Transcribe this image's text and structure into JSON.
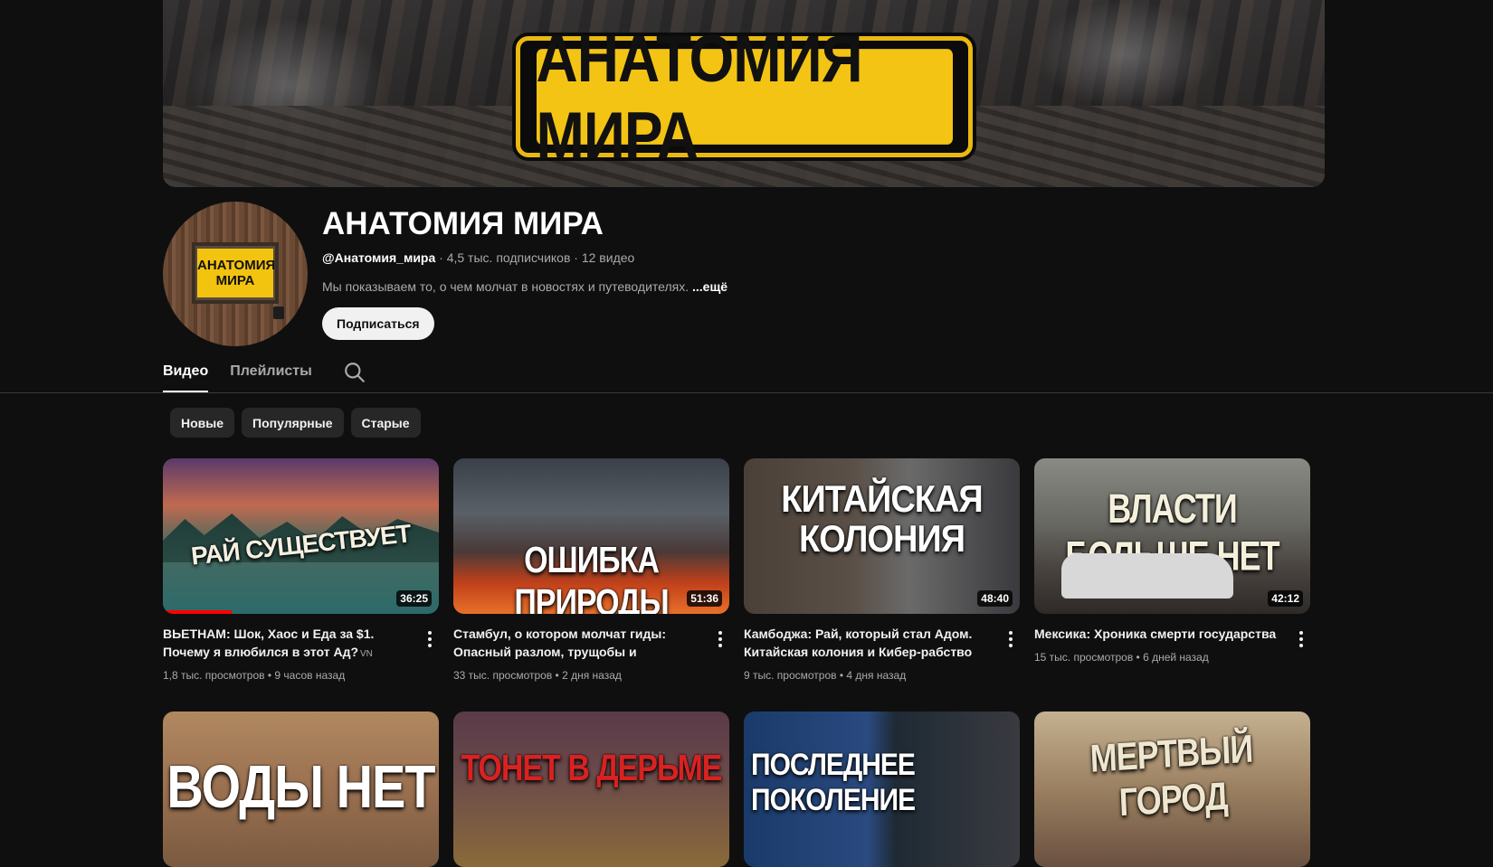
{
  "banner": {
    "logo_text": "АНАТОМИЯ МИРА"
  },
  "channel": {
    "avatar_text": "АНАТОМИЯ МИРА",
    "name": "АНАТОМИЯ МИРА",
    "handle": "@Анатомия_мира",
    "subscribers": " · 4,5 тыс. подписчиков",
    "video_count": " · 12 видео",
    "description": "Мы показываем то, о чем молчат в новостях и путеводителях. ",
    "more_label": "...ещё",
    "subscribe_label": "Подписаться"
  },
  "tabs": [
    {
      "label": "Видео",
      "active": true
    },
    {
      "label": "Плейлисты",
      "active": false
    }
  ],
  "tab_search_icon": "search-icon",
  "chips": [
    "Новые",
    "Популярные",
    "Старые"
  ],
  "videos": [
    {
      "thumb_text": "РАЙ СУЩЕСТВУЕТ",
      "duration": "36:25",
      "watched_fraction": 0.25,
      "title": "ВЬЕТНАМ: Шок, Хаос и Еда за $1. Почему я влюбился в этот Ад?",
      "lang_badge": "VN",
      "views": "1,8 тыс. просмотров",
      "age": "9 часов назад"
    },
    {
      "thumb_text": "ОШИБКА ПРИРОДЫ",
      "duration": "51:36",
      "title": "Стамбул, о котором молчат гиды: Опасный разлом, трущобы и реальная…",
      "views": "33 тыс. просмотров",
      "age": "2 дня назад"
    },
    {
      "thumb_text": "КИТАЙСКАЯ КОЛОНИЯ",
      "duration": "48:40",
      "title": "Камбоджа: Рай, который стал Адом. Китайская колония и Кибер-рабство",
      "views": "9 тыс. просмотров",
      "age": "4 дня назад"
    },
    {
      "thumb_text": "ВЛАСТИ БОЛЬШЕ НЕТ",
      "duration": "42:12",
      "title": "Мексика: Хроника смерти государства",
      "views": "15 тыс. просмотров",
      "age": "6 дней назад"
    },
    {
      "thumb_text": "ВОДЫ НЕТ"
    },
    {
      "thumb_text": "ТОНЕТ В ДЕРЬМЕ"
    },
    {
      "thumb_text": "ПОСЛЕДНЕЕ ПОКОЛЕНИЕ"
    },
    {
      "thumb_text": "МЕРТВЫЙ ГОРОД"
    }
  ],
  "stats_separator": " • "
}
